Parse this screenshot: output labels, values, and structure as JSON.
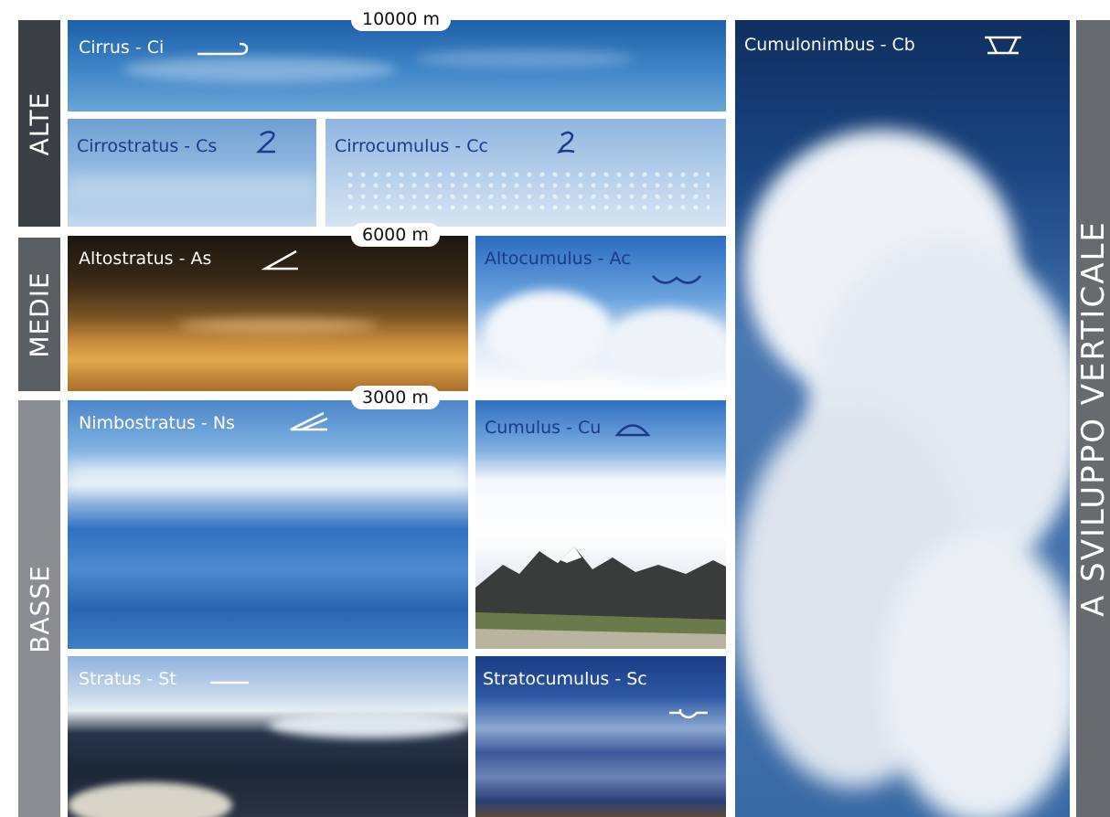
{
  "categories": {
    "alte": "ALTE",
    "medie": "MEDIE",
    "basse": "BASSE",
    "vertical": "A  SVILUPPO  VERTICALE"
  },
  "altitudes": {
    "top": "10000 m",
    "mid": "6000 m",
    "low": "3000 m"
  },
  "clouds": {
    "cirrus": {
      "label": "Cirrus - Ci",
      "symbol": "cirrus-symbol-icon"
    },
    "cirrostratus": {
      "label": "Cirrostratus - Cs",
      "symbol": "cirrostratus-symbol-icon"
    },
    "cirrocumulus": {
      "label": "Cirrocumulus - Cc",
      "symbol": "cirrocumulus-symbol-icon"
    },
    "altostratus": {
      "label": "Altostratus - As",
      "symbol": "altostratus-symbol-icon"
    },
    "altocumulus": {
      "label": "Altocumulus - Ac",
      "symbol": "altocumulus-symbol-icon"
    },
    "nimbostratus": {
      "label": "Nimbostratus - Ns",
      "symbol": "nimbostratus-symbol-icon"
    },
    "cumulus": {
      "label": "Cumulus - Cu",
      "symbol": "cumulus-symbol-icon"
    },
    "stratus": {
      "label": "Stratus - St",
      "symbol": "stratus-symbol-icon"
    },
    "stratocumulus": {
      "label": "Stratocumulus - Sc",
      "symbol": "stratocumulus-symbol-icon"
    },
    "cumulonimbus": {
      "label": "Cumulonimbus - Cb",
      "symbol": "cumulonimbus-symbol-icon"
    }
  },
  "colors": {
    "label_blue": "#1b3a8c",
    "band_dark": "#3b4046",
    "band_mid": "#5a5f64",
    "band_light": "#8a8e92"
  }
}
